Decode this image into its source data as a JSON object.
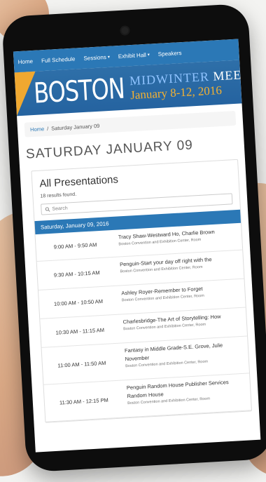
{
  "nav": [
    "Home",
    "Full Schedule",
    "Sessions",
    "Exhibit Hall",
    "Speakers"
  ],
  "banner": {
    "city": "BOSTON",
    "title_a": "MIDWINTER",
    "title_b": "MEETING",
    "dates": "January 8-12, 2016"
  },
  "breadcrumb": {
    "home": "Home",
    "sep": "/",
    "current": "Saturday January 09"
  },
  "page_title": "SATURDAY JANUARY 09",
  "panel": {
    "title": "All Presentations",
    "results": "18 results found.",
    "search_placeholder": "Search",
    "day_header": "Saturday, January 09, 2016"
  },
  "sessions": [
    {
      "time": "9:00 AM - 9:50 AM",
      "title": "Tracy Shaw-Westward Ho, Charlie Brown",
      "title2": "",
      "location": "Boston Convention and Exhibition Center, Room"
    },
    {
      "time": "9:30 AM - 10:15 AM",
      "title": "Penguin-Start your day off right with the",
      "title2": "",
      "location": "Boston Convention and Exhibition Center, Room"
    },
    {
      "time": "10:00 AM - 10:50 AM",
      "title": "Ashley Royer-Remember to Forget",
      "title2": "",
      "location": "Boston Convention and Exhibition Center, Room"
    },
    {
      "time": "10:30 AM - 11:15 AM",
      "title": "Charlesbridge-The Art of Storytelling: How",
      "title2": "",
      "location": "Boston Convention and Exhibition Center, Room"
    },
    {
      "time": "11:00 AM - 11:50 AM",
      "title": "Fantasy in Middle Grade-S.E. Grove, Julie",
      "title2": "November",
      "location": "Boston Convention and Exhibition Center, Room"
    },
    {
      "time": "11:30 AM - 12:15 PM",
      "title": "Penguin Random House Publisher Services",
      "title2": "Random House",
      "location": "Boston Convention and Exhibition Center, Room"
    }
  ]
}
